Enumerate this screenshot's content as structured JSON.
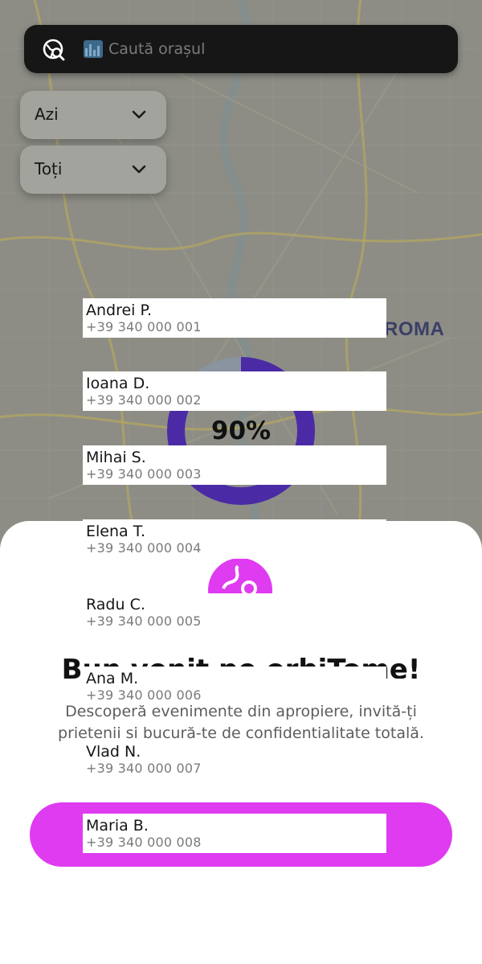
{
  "map": {
    "city_label": "ROMA"
  },
  "search": {
    "placeholder": "Caută orașul",
    "icon": "globe-search-icon",
    "emoji_icon": "cityscape-icon"
  },
  "filters": [
    {
      "label": "Azi",
      "icon": "chevron-down-icon"
    },
    {
      "label": "Toți",
      "icon": "chevron-down-icon"
    }
  ],
  "progress": {
    "value": 0.9,
    "label": "90%",
    "color": "#4b2aa5",
    "track_color": "#8a93a0"
  },
  "sheet": {
    "title": "Bun venit pe orbiTome!",
    "description": "Descoperă evenimente din apropiere, invită-ți prietenii si bucură-te de confidentialitate totală.",
    "accent_color": "#df3bf0",
    "logo_icon": "globe-logo-icon"
  },
  "contacts": [
    {
      "name": "Andrei P.",
      "phone": "+39 340 000 001"
    },
    {
      "name": "Ioana D.",
      "phone": "+39 340 000 002"
    },
    {
      "name": "Mihai S.",
      "phone": "+39 340 000 003"
    },
    {
      "name": "Elena T.",
      "phone": "+39 340 000 004"
    },
    {
      "name": "Radu C.",
      "phone": "+39 340 000 005"
    },
    {
      "name": "Ana M.",
      "phone": "+39 340 000 006"
    },
    {
      "name": "Vlad N.",
      "phone": "+39 340 000 007"
    },
    {
      "name": "Maria B.",
      "phone": "+39 340 000 008"
    }
  ]
}
